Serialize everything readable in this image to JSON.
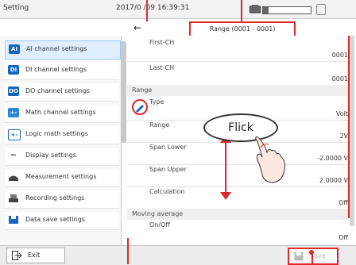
{
  "header": {
    "title": "Setting",
    "datetime": "2017/0 /09 16:39:31"
  },
  "range_bar": {
    "back_glyph": "←",
    "range_text": "Range (0001 - 0001)"
  },
  "sidebar": {
    "items": [
      {
        "icon": "AI",
        "label": "AI channel settings"
      },
      {
        "icon": "DI",
        "label": "DI channel settings"
      },
      {
        "icon": "DO",
        "label": "DO channel settings"
      },
      {
        "icon": "+-",
        "label": "Math channel settings"
      },
      {
        "icon": "+-",
        "label": "Logic math settings"
      },
      {
        "icon": "~",
        "label": "Display settings"
      },
      {
        "icon": "",
        "label": "Measurement settings"
      },
      {
        "icon": "",
        "label": "Recording settings"
      },
      {
        "icon": "",
        "label": "Data save settings"
      }
    ]
  },
  "content": {
    "first_ch_label": "First-CH",
    "first_ch_value": "0001",
    "last_ch_label": "Last-CH",
    "last_ch_value": "0001",
    "section_range": "Range",
    "type_label": "Type",
    "type_value": "Volt",
    "range_label": "Range",
    "range_value": "2V",
    "span_lower_label": "Span Lower",
    "span_lower_value": "-2.0000 V",
    "span_upper_label": "Span Upper",
    "span_upper_value": "2.0000 V",
    "calc_label": "Calculation",
    "calc_value": "Off",
    "section_moving": "Moving average",
    "onoff_label": "On/Off",
    "onoff_value": "Off"
  },
  "annotation": {
    "flick": "Flick"
  },
  "footer": {
    "exit_label": "Exit",
    "save_label": "Save"
  },
  "colors": {
    "accent_red": "#e0282a",
    "nav_blue": "#1565c0"
  }
}
